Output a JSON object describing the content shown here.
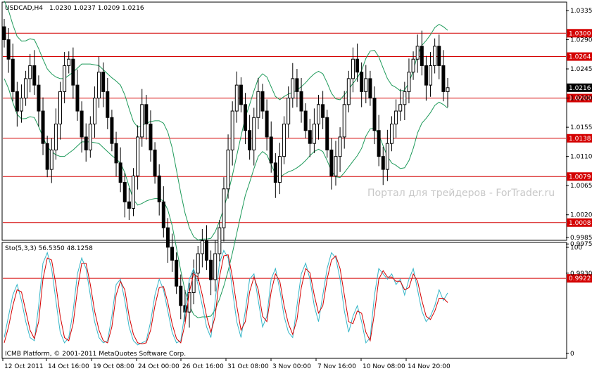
{
  "header": {
    "symbol": "USDCAD,H4",
    "ohlc": "1.0230 1.0237 1.0209 1.0216"
  },
  "watermark": "Портал для трейдеров - ForTrader.ru",
  "copyright": "ICMB Platform, © 2001-2011 MetaQuotes Software Corp.",
  "indicator_label": "Sto(5,3,3) 56.5350 48.1258",
  "colors": {
    "candle": "#000000",
    "band": "#1e9a5a",
    "level_line": "#d40000",
    "stoch_main": "#35b6c8",
    "stoch_signal": "#d40000",
    "level_label_bg": "#d40000",
    "price_label_bg": "#000000",
    "background": "#ffffff"
  },
  "chart_data": [
    {
      "type": "candlestick",
      "title": "USDCAD,H4",
      "current_price": "1.0216",
      "ylim": [
        0.9985,
        1.0335
      ],
      "y_ticks": [
        "1.0335",
        "1.0290",
        "1.0245",
        "1.0200",
        "1.0155",
        "1.0110",
        "1.0065",
        "1.0020",
        "0.9975",
        "0.9930",
        "0.9985"
      ],
      "x_tick_labels": [
        "12 Oct 2011",
        "14 Oct 16:00",
        "19 Oct 08:00",
        "24 Oct 00:00",
        "26 Oct 16:00",
        "31 Oct 08:00",
        "3 Nov 00:00",
        "7 Nov 16:00",
        "10 Nov 08:00",
        "14 Nov 20:00"
      ],
      "horizontal_levels": [
        "1.0300",
        "1.0264",
        "1.0200",
        "1.0138",
        "1.0079",
        "1.0008",
        "0.9922"
      ],
      "series": [
        {
          "name": "close",
          "values": [
            1.029,
            1.026,
            1.021,
            1.018,
            1.02,
            1.023,
            1.025,
            1.022,
            1.018,
            1.013,
            1.009,
            1.012,
            1.016,
            1.021,
            1.025,
            1.026,
            1.022,
            1.018,
            1.014,
            1.012,
            1.016,
            1.02,
            1.024,
            1.021,
            1.017,
            1.013,
            1.01,
            1.007,
            1.004,
            1.003,
            1.008,
            1.014,
            1.019,
            1.016,
            1.012,
            1.008,
            1.004,
            1.0,
            0.997,
            0.995,
            0.991,
            0.988,
            0.987,
            0.99,
            0.993,
            0.996,
            0.998,
            0.995,
            0.992,
            0.996,
            1.0,
            1.006,
            1.012,
            1.018,
            1.022,
            1.019,
            1.015,
            1.012,
            1.017,
            1.021,
            1.018,
            1.014,
            1.01,
            1.007,
            1.011,
            1.016,
            1.02,
            1.023,
            1.021,
            1.018,
            1.015,
            1.013,
            1.016,
            1.019,
            1.017,
            1.012,
            1.008,
            1.011,
            1.014,
            1.019,
            1.023,
            1.026,
            1.024,
            1.021,
            1.023,
            1.02,
            1.015,
            1.011,
            1.009,
            1.013,
            1.016,
            1.018,
            1.019,
            1.021,
            1.024,
            1.026,
            1.028,
            1.025,
            1.022,
            1.025,
            1.028,
            1.025,
            1.021,
            1.0216
          ]
        }
      ]
    },
    {
      "type": "line",
      "title": "Sto(5,3,3)",
      "ylim": [
        0,
        100
      ],
      "y_ticks": [
        "100",
        "0"
      ],
      "series": [
        {
          "name": "main",
          "values": [
            15,
            35,
            55,
            65,
            50,
            30,
            15,
            12,
            45,
            85,
            95,
            80,
            50,
            20,
            10,
            15,
            40,
            75,
            90,
            80,
            55,
            30,
            15,
            10,
            12,
            35,
            65,
            70,
            50,
            25,
            12,
            8,
            10,
            12,
            30,
            55,
            70,
            60,
            40,
            20,
            10,
            12,
            40,
            70,
            80,
            65,
            45,
            25,
            15,
            50,
            85,
            97,
            90,
            60,
            30,
            15,
            40,
            70,
            75,
            50,
            25,
            35,
            70,
            80,
            60,
            35,
            20,
            15,
            45,
            75,
            85,
            70,
            45,
            30,
            55,
            80,
            95,
            90,
            70,
            40,
            20,
            35,
            45,
            30,
            10,
            15,
            55,
            80,
            75,
            70,
            75,
            65,
            70,
            55,
            70,
            80,
            60,
            40,
            30,
            35,
            45,
            60,
            50,
            57
          ]
        },
        {
          "name": "signal",
          "values": [
            10,
            25,
            45,
            60,
            58,
            40,
            22,
            14,
            30,
            70,
            90,
            88,
            65,
            35,
            15,
            12,
            28,
            60,
            85,
            85,
            65,
            40,
            22,
            12,
            10,
            25,
            55,
            68,
            60,
            35,
            18,
            10,
            9,
            10,
            22,
            45,
            62,
            63,
            48,
            28,
            14,
            10,
            28,
            58,
            75,
            72,
            55,
            35,
            20,
            35,
            72,
            92,
            93,
            72,
            45,
            22,
            30,
            58,
            72,
            60,
            35,
            30,
            58,
            75,
            68,
            45,
            28,
            18,
            32,
            62,
            80,
            76,
            55,
            38,
            45,
            70,
            88,
            92,
            80,
            55,
            30,
            28,
            40,
            38,
            20,
            12,
            38,
            70,
            78,
            72,
            72,
            68,
            68,
            60,
            62,
            75,
            68,
            50,
            35,
            32,
            40,
            52,
            52,
            48
          ]
        }
      ]
    }
  ]
}
